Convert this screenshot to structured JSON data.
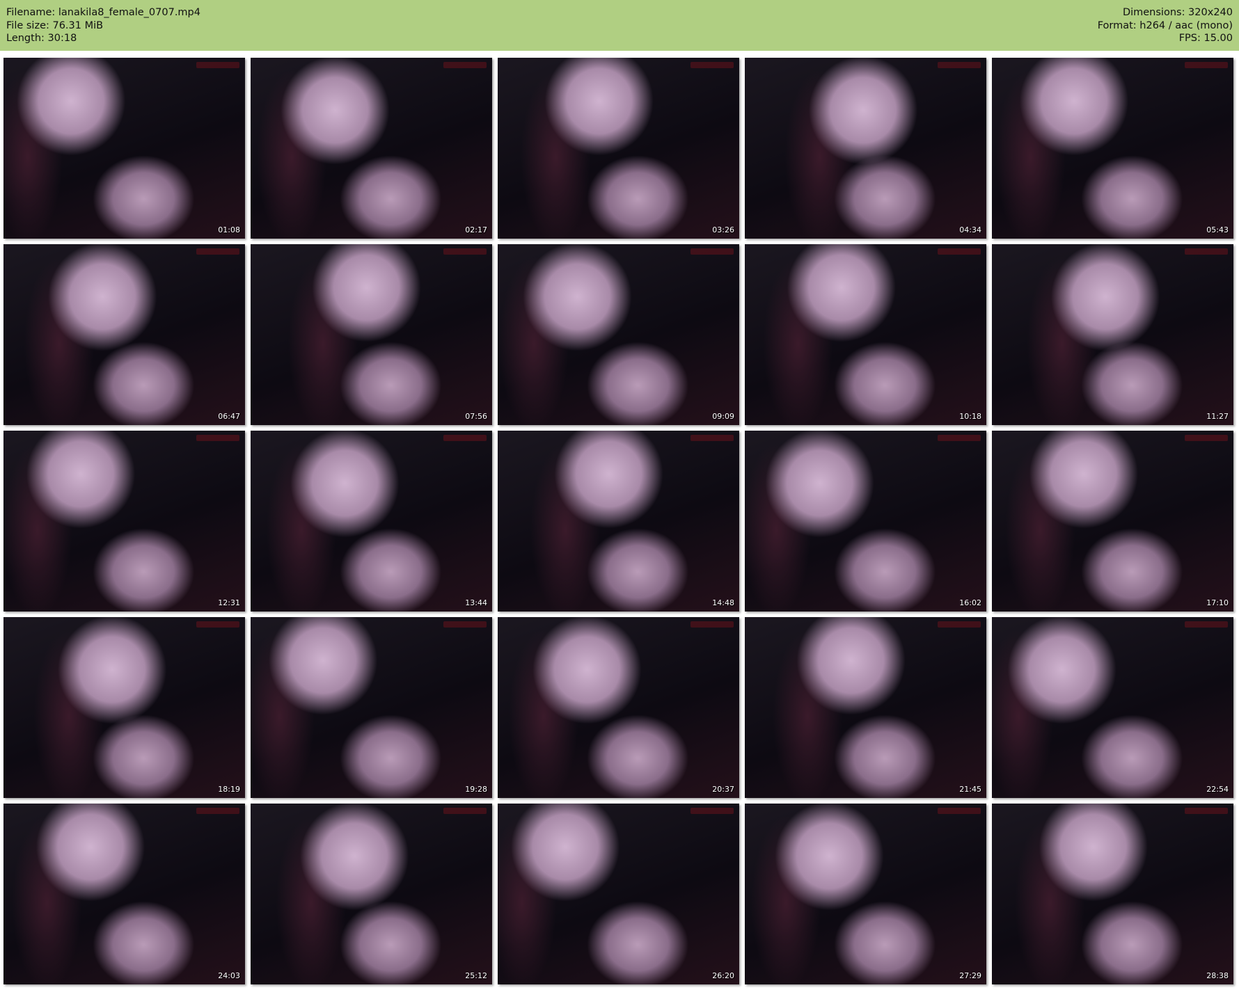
{
  "header": {
    "filename": "Filename: lanakila8_female_0707.mp4",
    "file_size": "File size: 76.31 MiB",
    "length": "Length: 30:18",
    "dimensions": "Dimensions: 320x240",
    "format": "Format: h264 / aac (mono)",
    "fps": "FPS: 15.00"
  },
  "colors": {
    "header_bg": "#b0cf82",
    "page_bg": "#ffffff",
    "frame_dark": "#0d0a12",
    "skin_light": "#cfb3cf",
    "hair": "#3a1a2a"
  },
  "thumbnails": [
    {
      "timestamp": "01:08"
    },
    {
      "timestamp": "02:17"
    },
    {
      "timestamp": "03:26"
    },
    {
      "timestamp": "04:34"
    },
    {
      "timestamp": "05:43"
    },
    {
      "timestamp": "06:47"
    },
    {
      "timestamp": "07:56"
    },
    {
      "timestamp": "09:09"
    },
    {
      "timestamp": "10:18"
    },
    {
      "timestamp": "11:27"
    },
    {
      "timestamp": "12:31"
    },
    {
      "timestamp": "13:44"
    },
    {
      "timestamp": "14:48"
    },
    {
      "timestamp": "16:02"
    },
    {
      "timestamp": "17:10"
    },
    {
      "timestamp": "18:19"
    },
    {
      "timestamp": "19:28"
    },
    {
      "timestamp": "20:37"
    },
    {
      "timestamp": "21:45"
    },
    {
      "timestamp": "22:54"
    },
    {
      "timestamp": "24:03"
    },
    {
      "timestamp": "25:12"
    },
    {
      "timestamp": "26:20"
    },
    {
      "timestamp": "27:29"
    },
    {
      "timestamp": "28:38"
    }
  ]
}
